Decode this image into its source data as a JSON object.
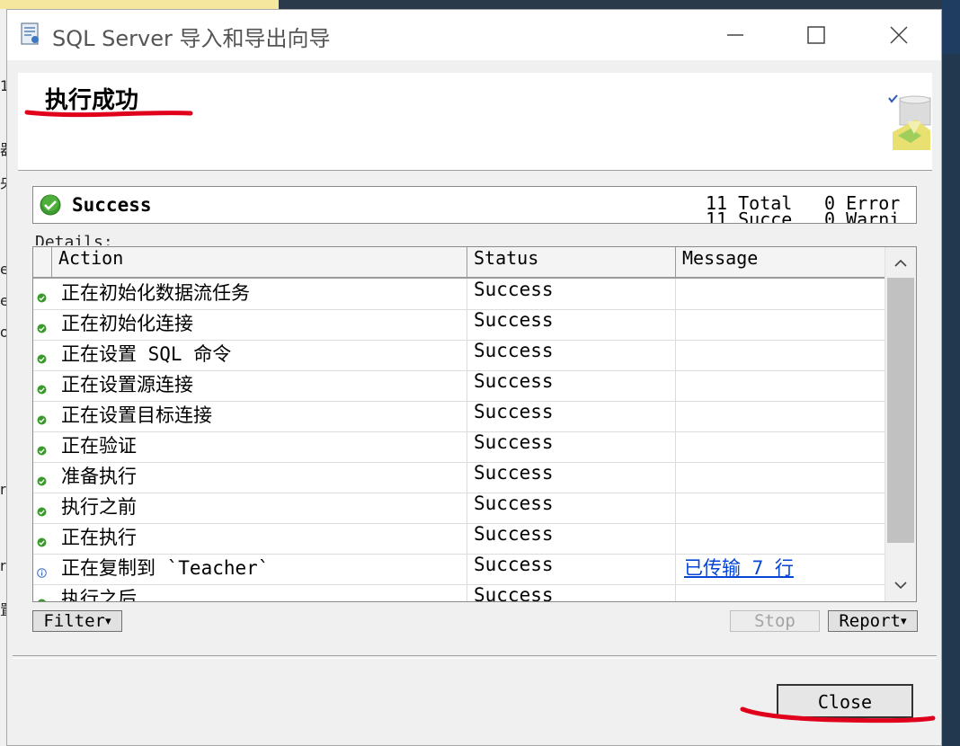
{
  "background": {
    "left_fragments": [
      "1",
      "器",
      "央",
      "e",
      "e",
      "o",
      "r",
      "r",
      "置"
    ]
  },
  "window": {
    "title": "SQL Server 导入和导出向导",
    "icons": {
      "app": "wizard-app-icon",
      "minimize": "minimize-icon",
      "maximize": "maximize-icon",
      "close": "close-icon"
    }
  },
  "header": {
    "title": "执行成功",
    "graphic": "package-success-graphic",
    "accent_underline_color": "#e0001b"
  },
  "summary": {
    "status": "Success",
    "status_icon": "success-check-icon",
    "total": "11 Total",
    "success": "11 Succe",
    "error": "0 Error",
    "warning": "0 Warni"
  },
  "details": {
    "label": "Details:",
    "columns": {
      "action": "Action",
      "status": "Status",
      "message": "Message"
    },
    "rows": [
      {
        "action": "正在初始化数据流任务",
        "status": "Success",
        "message": "",
        "icon": "success-dot-icon"
      },
      {
        "action": "正在初始化连接",
        "status": "Success",
        "message": "",
        "icon": "success-dot-icon"
      },
      {
        "action": "正在设置 SQL 命令",
        "status": "Success",
        "message": "",
        "icon": "success-dot-icon"
      },
      {
        "action": "正在设置源连接",
        "status": "Success",
        "message": "",
        "icon": "success-dot-icon"
      },
      {
        "action": "正在设置目标连接",
        "status": "Success",
        "message": "",
        "icon": "success-dot-icon"
      },
      {
        "action": "正在验证",
        "status": "Success",
        "message": "",
        "icon": "success-dot-icon"
      },
      {
        "action": "准备执行",
        "status": "Success",
        "message": "",
        "icon": "success-dot-icon"
      },
      {
        "action": "执行之前",
        "status": "Success",
        "message": "",
        "icon": "success-dot-icon"
      },
      {
        "action": "正在执行",
        "status": "Success",
        "message": "",
        "icon": "success-dot-icon"
      },
      {
        "action": "正在复制到 `Teacher`",
        "status": "Success",
        "message": "已传输 7 行",
        "icon": "info-icon"
      },
      {
        "action": "执行之后",
        "status": "Success",
        "message": "",
        "icon": "success-dot-icon"
      }
    ]
  },
  "buttons": {
    "filter": "Filter",
    "stop": "Stop",
    "report": "Report",
    "close": "Close"
  }
}
